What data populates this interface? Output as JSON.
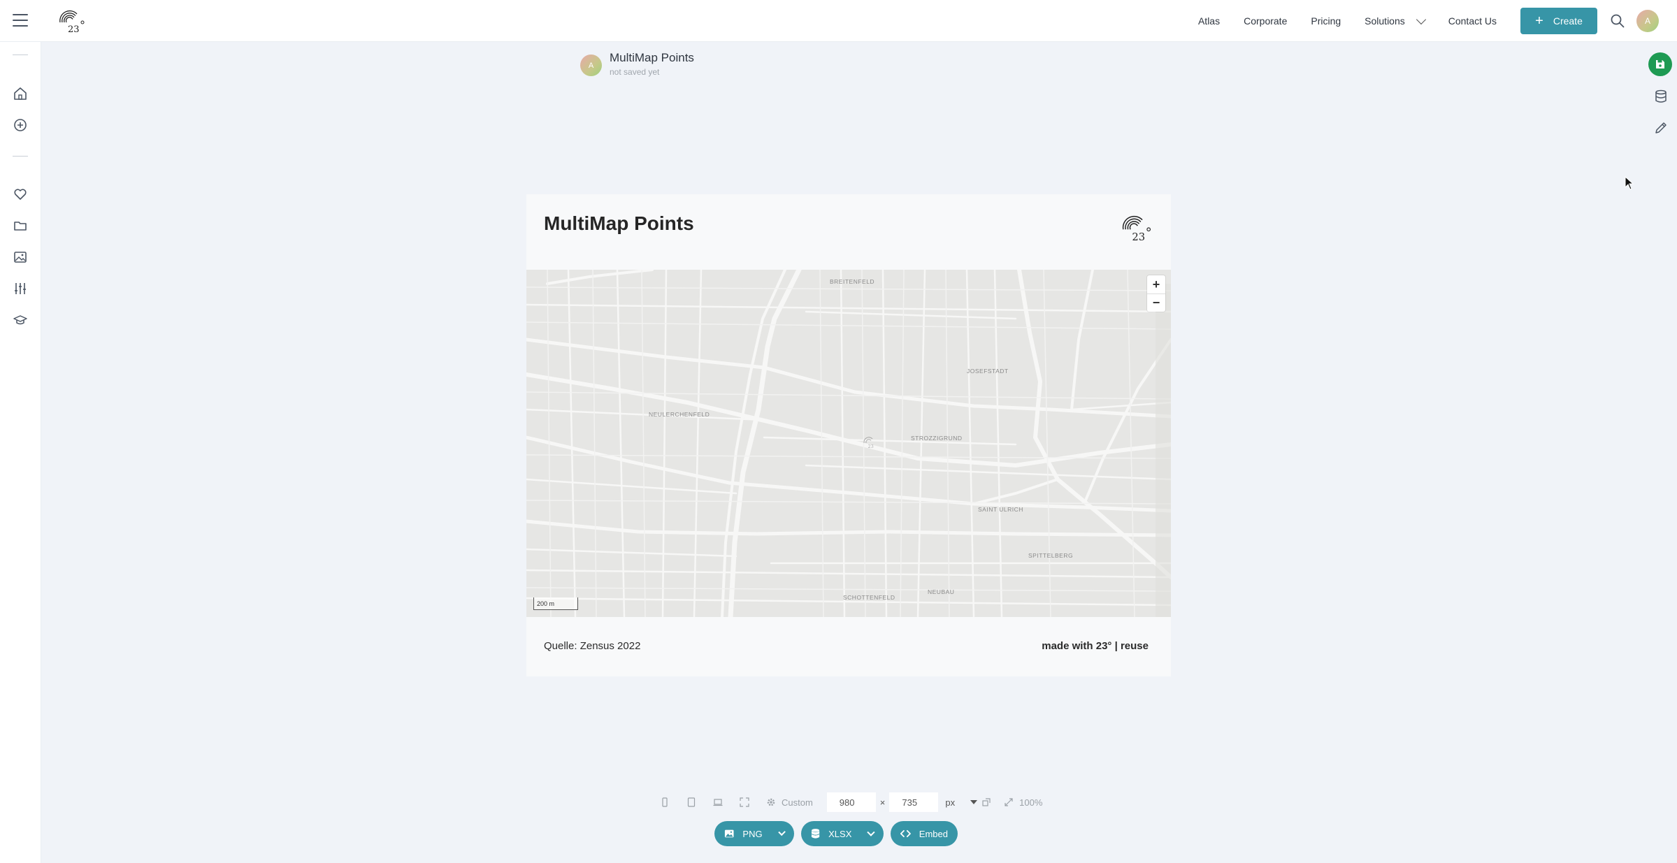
{
  "header": {
    "nav": [
      "Atlas",
      "Corporate",
      "Pricing",
      "Solutions",
      "Contact Us"
    ],
    "create_label": "Create",
    "user_initial": "A"
  },
  "sidebar": {
    "icons": [
      "home-icon",
      "add-circle-icon",
      "heart-icon",
      "folder-icon",
      "image-icon",
      "sliders-icon",
      "graduation-cap-icon"
    ]
  },
  "right_rail": {
    "icons": [
      "save-icon",
      "database-icon",
      "pencil-icon"
    ],
    "save_color": "#1e9a53"
  },
  "document": {
    "title": "MultiMap Points",
    "status": "not saved yet",
    "author_initial": "A"
  },
  "card": {
    "title": "MultiMap Points",
    "source": "Quelle: Zensus 2022",
    "credit": "made with 23° | reuse",
    "map": {
      "scale_label": "200 m",
      "zoom_in": "+",
      "zoom_out": "−",
      "districts": [
        "BREITENFELD",
        "JOSEFSTADT",
        "NEULERCHENFELD",
        "STROZZIGRUND",
        "SAINT ULRICH",
        "SPITTELBERG",
        "SCHOTTENFELD",
        "NEUBAU"
      ]
    }
  },
  "toolbar": {
    "preset": "Custom",
    "width": "980",
    "times": "×",
    "height": "735",
    "unit": "px",
    "zoom": "100%"
  },
  "export": {
    "png": "PNG",
    "xlsx": "XLSX",
    "embed": "Embed"
  },
  "colors": {
    "accent": "#3795a7",
    "background": "#f0f3f8"
  }
}
